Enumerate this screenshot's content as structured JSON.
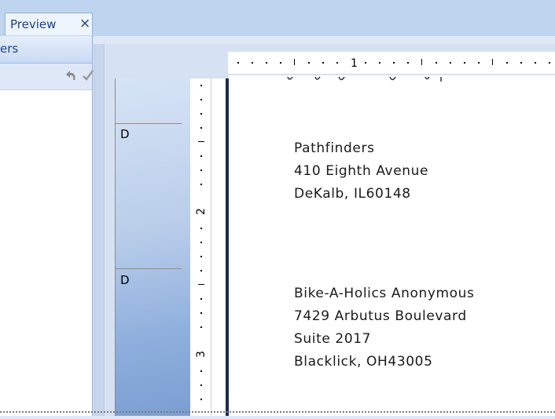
{
  "tab": {
    "label": "Preview",
    "close_glyph": "×"
  },
  "left_panel": {
    "header_text": "ers"
  },
  "ruler": {
    "horizontal_mark": "1",
    "vertical_marks": [
      "2",
      "3"
    ]
  },
  "bands": [
    {
      "letter": "D"
    },
    {
      "letter": "D"
    }
  ],
  "addresses": [
    {
      "lines": [
        "Pathfinders",
        "410 Eighth Avenue",
        "DeKalb, IL60148"
      ]
    },
    {
      "lines": [
        "Bike-A-Holics Anonymous",
        "7429 Arbutus Boulevard",
        "Suite 2017",
        "Blacklick, OH43005"
      ]
    }
  ],
  "icons": {
    "undo": "undo-icon",
    "check": "check-icon"
  },
  "colors": {
    "accent": "#15428b",
    "tab_strip": "#bfd4ee",
    "band_dark": "#7b9ed2"
  }
}
